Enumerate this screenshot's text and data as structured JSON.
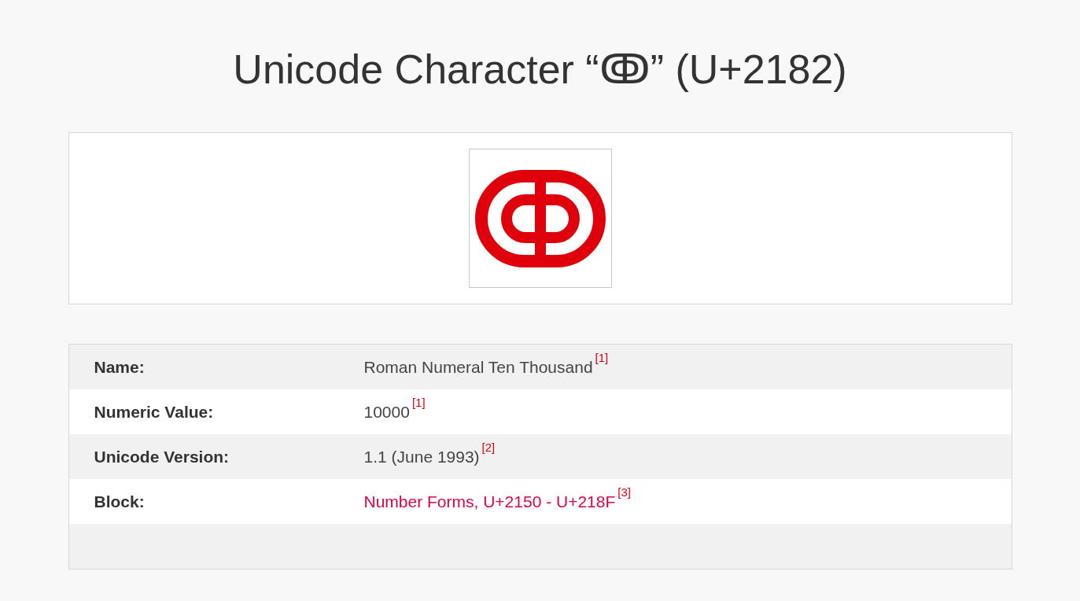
{
  "title": "Unicode Character “ↂ” (U+2182)",
  "properties": [
    {
      "label": "Name:",
      "value": "Roman Numeral Ten Thousand",
      "link": false,
      "footnote": "[1]"
    },
    {
      "label": "Numeric Value:",
      "value": "10000",
      "link": false,
      "footnote": "[1]"
    },
    {
      "label": "Unicode Version:",
      "value": "1.1 (June 1993)",
      "link": false,
      "footnote": "[2]"
    },
    {
      "label": "Block:",
      "value": "Number Forms, U+2150 - U+218F",
      "link": true,
      "footnote": "[3]"
    }
  ]
}
